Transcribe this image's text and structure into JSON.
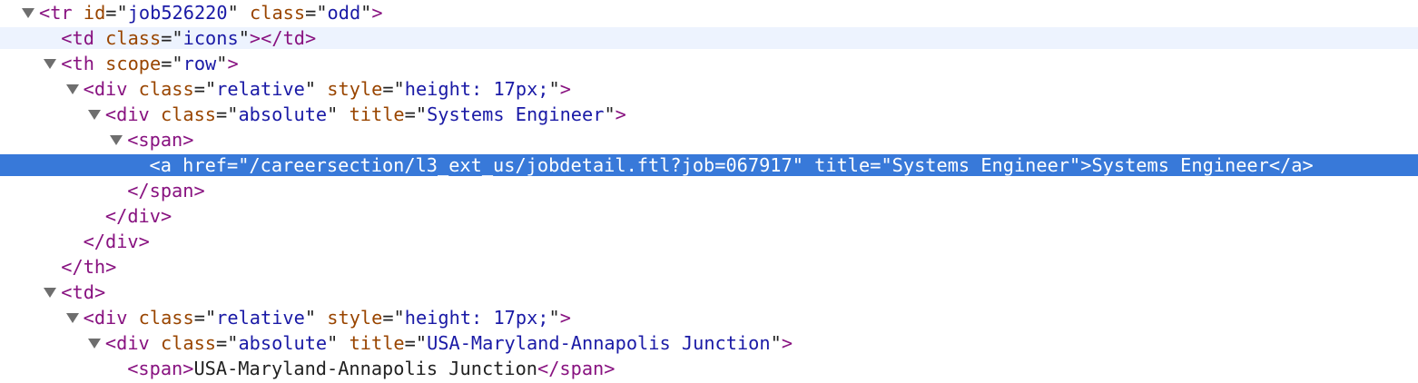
{
  "nodes": [
    {
      "kind": "open",
      "expanded": true,
      "state": "normal",
      "depth": 0,
      "tag": "tr",
      "attrs": [
        {
          "name": "id",
          "value": "job526220"
        },
        {
          "name": "class",
          "value": "odd"
        }
      ]
    },
    {
      "kind": "inline",
      "expanded": false,
      "state": "hover",
      "depth": 1,
      "tag": "td",
      "attrs": [
        {
          "name": "class",
          "value": "icons"
        }
      ],
      "text": ""
    },
    {
      "kind": "open",
      "expanded": true,
      "state": "normal",
      "depth": 1,
      "tag": "th",
      "attrs": [
        {
          "name": "scope",
          "value": "row"
        }
      ]
    },
    {
      "kind": "open",
      "expanded": true,
      "state": "normal",
      "depth": 2,
      "tag": "div",
      "attrs": [
        {
          "name": "class",
          "value": "relative"
        },
        {
          "name": "style",
          "value": "height: 17px;"
        }
      ]
    },
    {
      "kind": "open",
      "expanded": true,
      "state": "normal",
      "depth": 3,
      "tag": "div",
      "attrs": [
        {
          "name": "class",
          "value": "absolute"
        },
        {
          "name": "title",
          "value": "Systems Engineer"
        }
      ]
    },
    {
      "kind": "open",
      "expanded": true,
      "state": "normal",
      "depth": 4,
      "tag": "span",
      "attrs": []
    },
    {
      "kind": "inline",
      "expanded": false,
      "state": "selected",
      "depth": 5,
      "tag": "a",
      "attrs": [
        {
          "name": "href",
          "value": "/careersection/l3_ext_us/jobdetail.ftl?job=067917"
        },
        {
          "name": "title",
          "value": "Systems Engineer"
        }
      ],
      "text": "Systems Engineer"
    },
    {
      "kind": "close",
      "state": "normal",
      "depth": 4,
      "tag": "span"
    },
    {
      "kind": "close",
      "state": "normal",
      "depth": 3,
      "tag": "div"
    },
    {
      "kind": "close",
      "state": "normal",
      "depth": 2,
      "tag": "div"
    },
    {
      "kind": "close",
      "state": "normal",
      "depth": 1,
      "tag": "th"
    },
    {
      "kind": "open",
      "expanded": true,
      "state": "normal",
      "depth": 1,
      "tag": "td",
      "attrs": []
    },
    {
      "kind": "open",
      "expanded": true,
      "state": "normal",
      "depth": 2,
      "tag": "div",
      "attrs": [
        {
          "name": "class",
          "value": "relative"
        },
        {
          "name": "style",
          "value": "height: 17px;"
        }
      ]
    },
    {
      "kind": "open",
      "expanded": true,
      "state": "normal",
      "depth": 3,
      "tag": "div",
      "attrs": [
        {
          "name": "class",
          "value": "absolute"
        },
        {
          "name": "title",
          "value": "USA-Maryland-Annapolis Junction"
        }
      ]
    },
    {
      "kind": "inline",
      "expanded": false,
      "state": "normal",
      "depth": 4,
      "tag": "span",
      "attrs": [],
      "text": "USA-Maryland-Annapolis Junction"
    }
  ],
  "colors": {
    "tag": "#881280",
    "attr_name": "#994500",
    "attr_value": "#1a1aa6",
    "text": "#222222",
    "hover_row": "#edf3fe",
    "selected_row": "#3879d9",
    "disclosure_triangle": "#6e6e6e"
  },
  "icons": {
    "expanded": "disclosure-triangle-down-icon"
  }
}
